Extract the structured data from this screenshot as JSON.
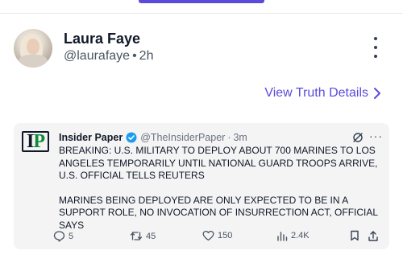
{
  "post": {
    "display_name": "Laura Faye",
    "handle": "@laurafaye",
    "separator": "•",
    "time": "2h",
    "view_details_label": "View Truth Details"
  },
  "embed": {
    "account_name": "Insider Paper",
    "account_handle": "@TheInsiderPaper",
    "time": "3m",
    "meta_separator": "·",
    "logo_text_1": "I",
    "logo_text_2": "P",
    "paragraphs": [
      "BREAKING: U.S. MILITARY TO DEPLOY ABOUT 700 MARINES TO LOS ANGELES TEMPORARILY UNTIL NATIONAL GUARD TROOPS ARRIVE, U.S. OFFICIAL TELLS REUTERS",
      "MARINES BEING DEPLOYED ARE ONLY EXPECTED TO BE IN A SUPPORT ROLE, NO INVOCATION OF INSURRECTION ACT, OFFICIAL SAYS"
    ],
    "more_label": "···",
    "stats": {
      "replies": "5",
      "reposts": "45",
      "likes": "150",
      "views": "2.4K"
    }
  },
  "colors": {
    "accent": "#5b4bdb",
    "verified": "#1d9bf0",
    "logo_green": "#0e8a3a"
  },
  "icons": {
    "more": "vertical-ellipsis-icon",
    "chevron": "chevron-right-icon",
    "verified": "verified-badge-icon",
    "grok": "grok-icon",
    "reply": "reply-icon",
    "repost": "repost-icon",
    "like": "heart-icon",
    "views": "views-chart-icon",
    "bookmark": "bookmark-icon",
    "share": "share-icon"
  }
}
